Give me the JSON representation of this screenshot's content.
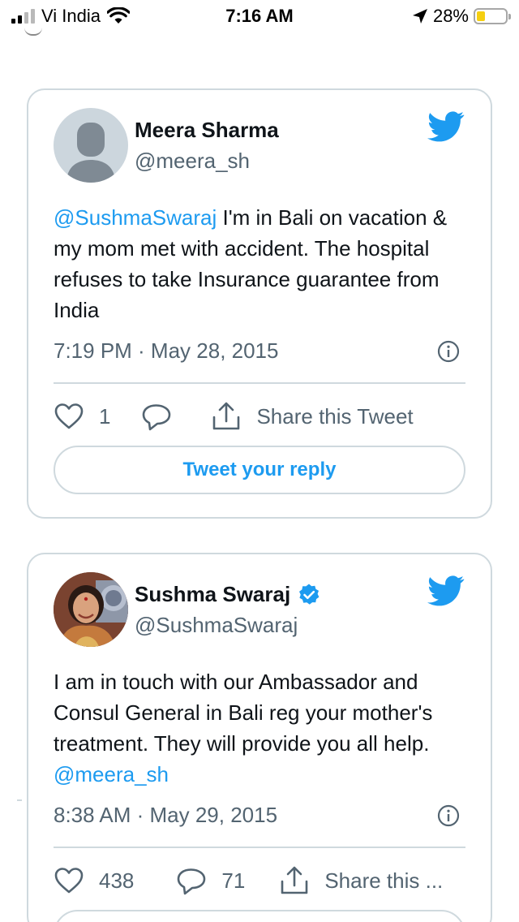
{
  "status_bar": {
    "carrier": "Vi India",
    "time": "7:16 AM",
    "battery_percent": "28%",
    "battery_level": 0.28,
    "signal_bars": 2,
    "signal_bars_total": 4,
    "icons": [
      "signal-icon",
      "wifi-icon",
      "location-arrow-icon",
      "battery-icon"
    ]
  },
  "colors": {
    "accent": "#1d9bf0",
    "text": "#0f1419",
    "secondary": "#536471",
    "border": "#cfd9de",
    "battery": "#f5cf11"
  },
  "tweets": [
    {
      "name": "Meera Sharma",
      "handle": "@meera_sh",
      "verified": false,
      "text_mention": "@SushmaSwaraj",
      "text_body": " I'm in Bali on vacation & my mom met with accident. The hospital refuses to take Insurance guarantee from India",
      "timestamp": "7:19 PM · May 28, 2015",
      "likes": "1",
      "reply_icon": "reply-icon",
      "share_label": "Share this Tweet",
      "reply_button": "Tweet your reply"
    },
    {
      "name": "Sushma Swaraj",
      "handle": "@SushmaSwaraj",
      "verified": true,
      "text_body": "I am in touch with our Ambassador and Consul General in Bali reg your mother's treatment. They will provide you all help. ",
      "text_mention": "@meera_sh",
      "timestamp": "8:38 AM · May 29, 2015",
      "likes": "438",
      "replies": "71",
      "share_label": "Share this ..."
    }
  ]
}
